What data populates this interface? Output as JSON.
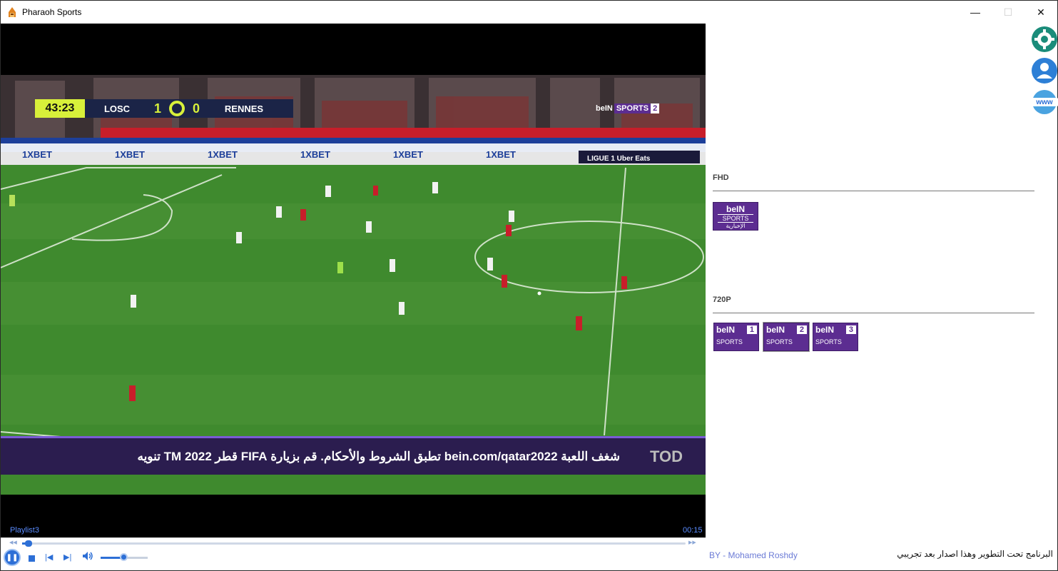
{
  "window": {
    "title": "Pharaoh Sports",
    "minimize": "—",
    "maximize": "☐",
    "close": "✕"
  },
  "video": {
    "scoreboard": {
      "clock": "43:23",
      "home_team": "LOSC",
      "home_score": "1",
      "away_score": "0",
      "away_team": "RENNES"
    },
    "channel_bug": {
      "brand": "beIN",
      "sports": "SPORTS",
      "num": "2"
    },
    "ticker_text": "شغف اللعبة   bein.com/qatar2022 تطبق الشروط والأحكام. قم بزيارة FIFA قطر 2022 TM   تنويه",
    "ticker_logo": "TOD"
  },
  "player": {
    "playlist_label": "Playlist3",
    "time": "00:15",
    "progress_fraction": 0.01,
    "volume_fraction": 0.5
  },
  "sidebar": {
    "icons": [
      "gear-icon",
      "user-icon",
      "www-globe-icon"
    ],
    "www_label": "www",
    "sections": [
      {
        "title": "FHD",
        "channels": [
          {
            "brand": "beIN",
            "sports": "SPORTS",
            "sub": "الإخبارية"
          }
        ]
      },
      {
        "title": "720P",
        "channels": [
          {
            "brand": "beIN",
            "sports": "SPORTS",
            "num": "1"
          },
          {
            "brand": "beIN",
            "sports": "SPORTS",
            "num": "2"
          },
          {
            "brand": "beIN",
            "sports": "SPORTS",
            "num": "3"
          }
        ]
      }
    ]
  },
  "footer": {
    "credit": "BY - Mohamed Roshdy",
    "notice": "البرنامج تحت التطوير وهذا اصدار بعد تجريبي"
  },
  "colors": {
    "accent": "#2d6fd6",
    "bein_purple": "#5c2d91",
    "pitch": "#3f8a2e"
  }
}
